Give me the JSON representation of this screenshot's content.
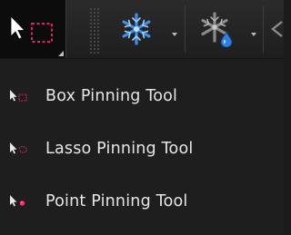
{
  "toolbar": {
    "active_tool_icon": "box-pinning-tool-icon",
    "freeze_icon": "snowflake-icon",
    "thaw_icon": "snowflake-drop-icon",
    "colors": {
      "snowflake": "#3f8fe8",
      "pin_accent": "#e0245a"
    }
  },
  "menu": {
    "items": [
      {
        "label": "Box Pinning Tool",
        "icon": "box-pinning-icon"
      },
      {
        "label": "Lasso Pinning Tool",
        "icon": "lasso-pinning-icon"
      },
      {
        "label": "Point Pinning Tool",
        "icon": "point-pinning-icon"
      }
    ]
  }
}
